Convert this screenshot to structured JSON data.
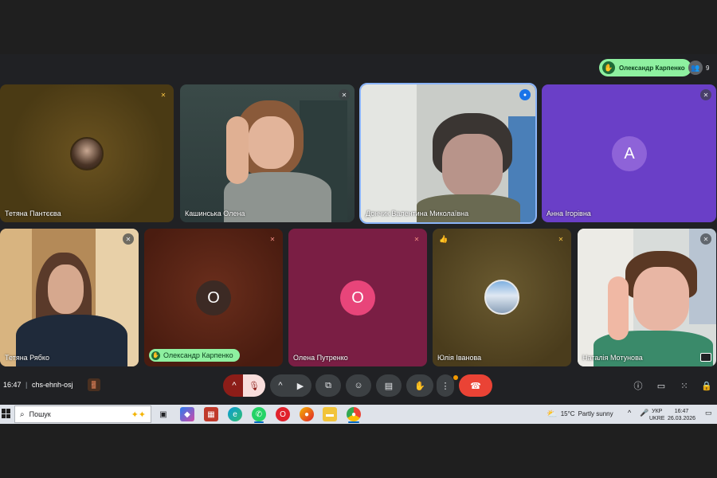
{
  "hand_raised_chip": "Олександр Карпенко",
  "participants_count": "9",
  "tiles": [
    {
      "name": "Тетяна Пантєєва"
    },
    {
      "name": "Кашинська Олена"
    },
    {
      "name": "Дончик Валентина Миколаївна"
    },
    {
      "name": "Анна Ігорівна",
      "initial": "А"
    },
    {
      "name": "Тетяна Рябко"
    },
    {
      "name": "Олександр Карпенко",
      "initial": "О"
    },
    {
      "name": "Олена Путренко",
      "initial": "О"
    },
    {
      "name": "Юлія Іванова"
    },
    {
      "name": "Наталія Мотунова"
    }
  ],
  "meeting": {
    "time": "16:47",
    "separator": "|",
    "code": "chs-ehnh-osj"
  },
  "taskbar": {
    "search_placeholder": "Пошук",
    "weather_temp": "15°C",
    "weather_desc": "Partly sunny",
    "lang_line1": "УКР",
    "lang_line2": "UKRE",
    "clock_time": "16:47",
    "clock_date": "26.03.2026"
  },
  "colors": {
    "hand_chip": "#8ef0a0",
    "leave_button": "#ea4335",
    "tile_purple": "#6a3fc7",
    "tile_pink": "#7a1e44"
  }
}
